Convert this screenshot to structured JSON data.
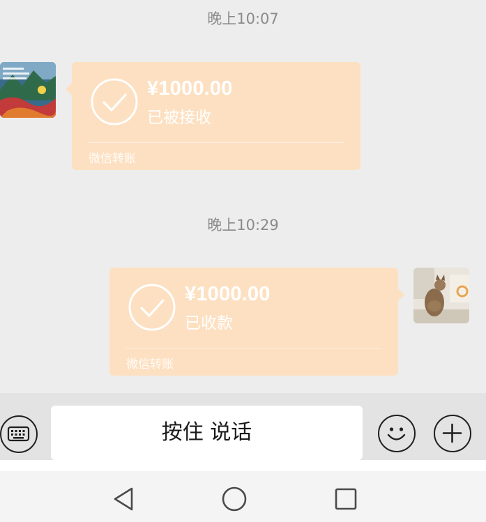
{
  "chat": {
    "messages": [
      {
        "timestamp": "晚上10:07",
        "side": "left",
        "amount": "¥1000.00",
        "status": "已被接收",
        "source": "微信转账"
      },
      {
        "timestamp": "晚上10:29",
        "side": "right",
        "amount": "¥1000.00",
        "status": "已收款",
        "source": "微信转账"
      }
    ]
  },
  "input_bar": {
    "hold_to_talk_label": "按住 说话",
    "left_icon": "keyboard-icon",
    "right_icons": [
      "emoji-icon",
      "plus-icon"
    ]
  },
  "nav_bar": {
    "buttons": [
      "back-icon",
      "home-icon",
      "recents-icon"
    ]
  },
  "colors": {
    "transfer_bubble": "#fde0c1",
    "chat_background": "#ededed",
    "timestamp_text": "#8a8a8a"
  }
}
